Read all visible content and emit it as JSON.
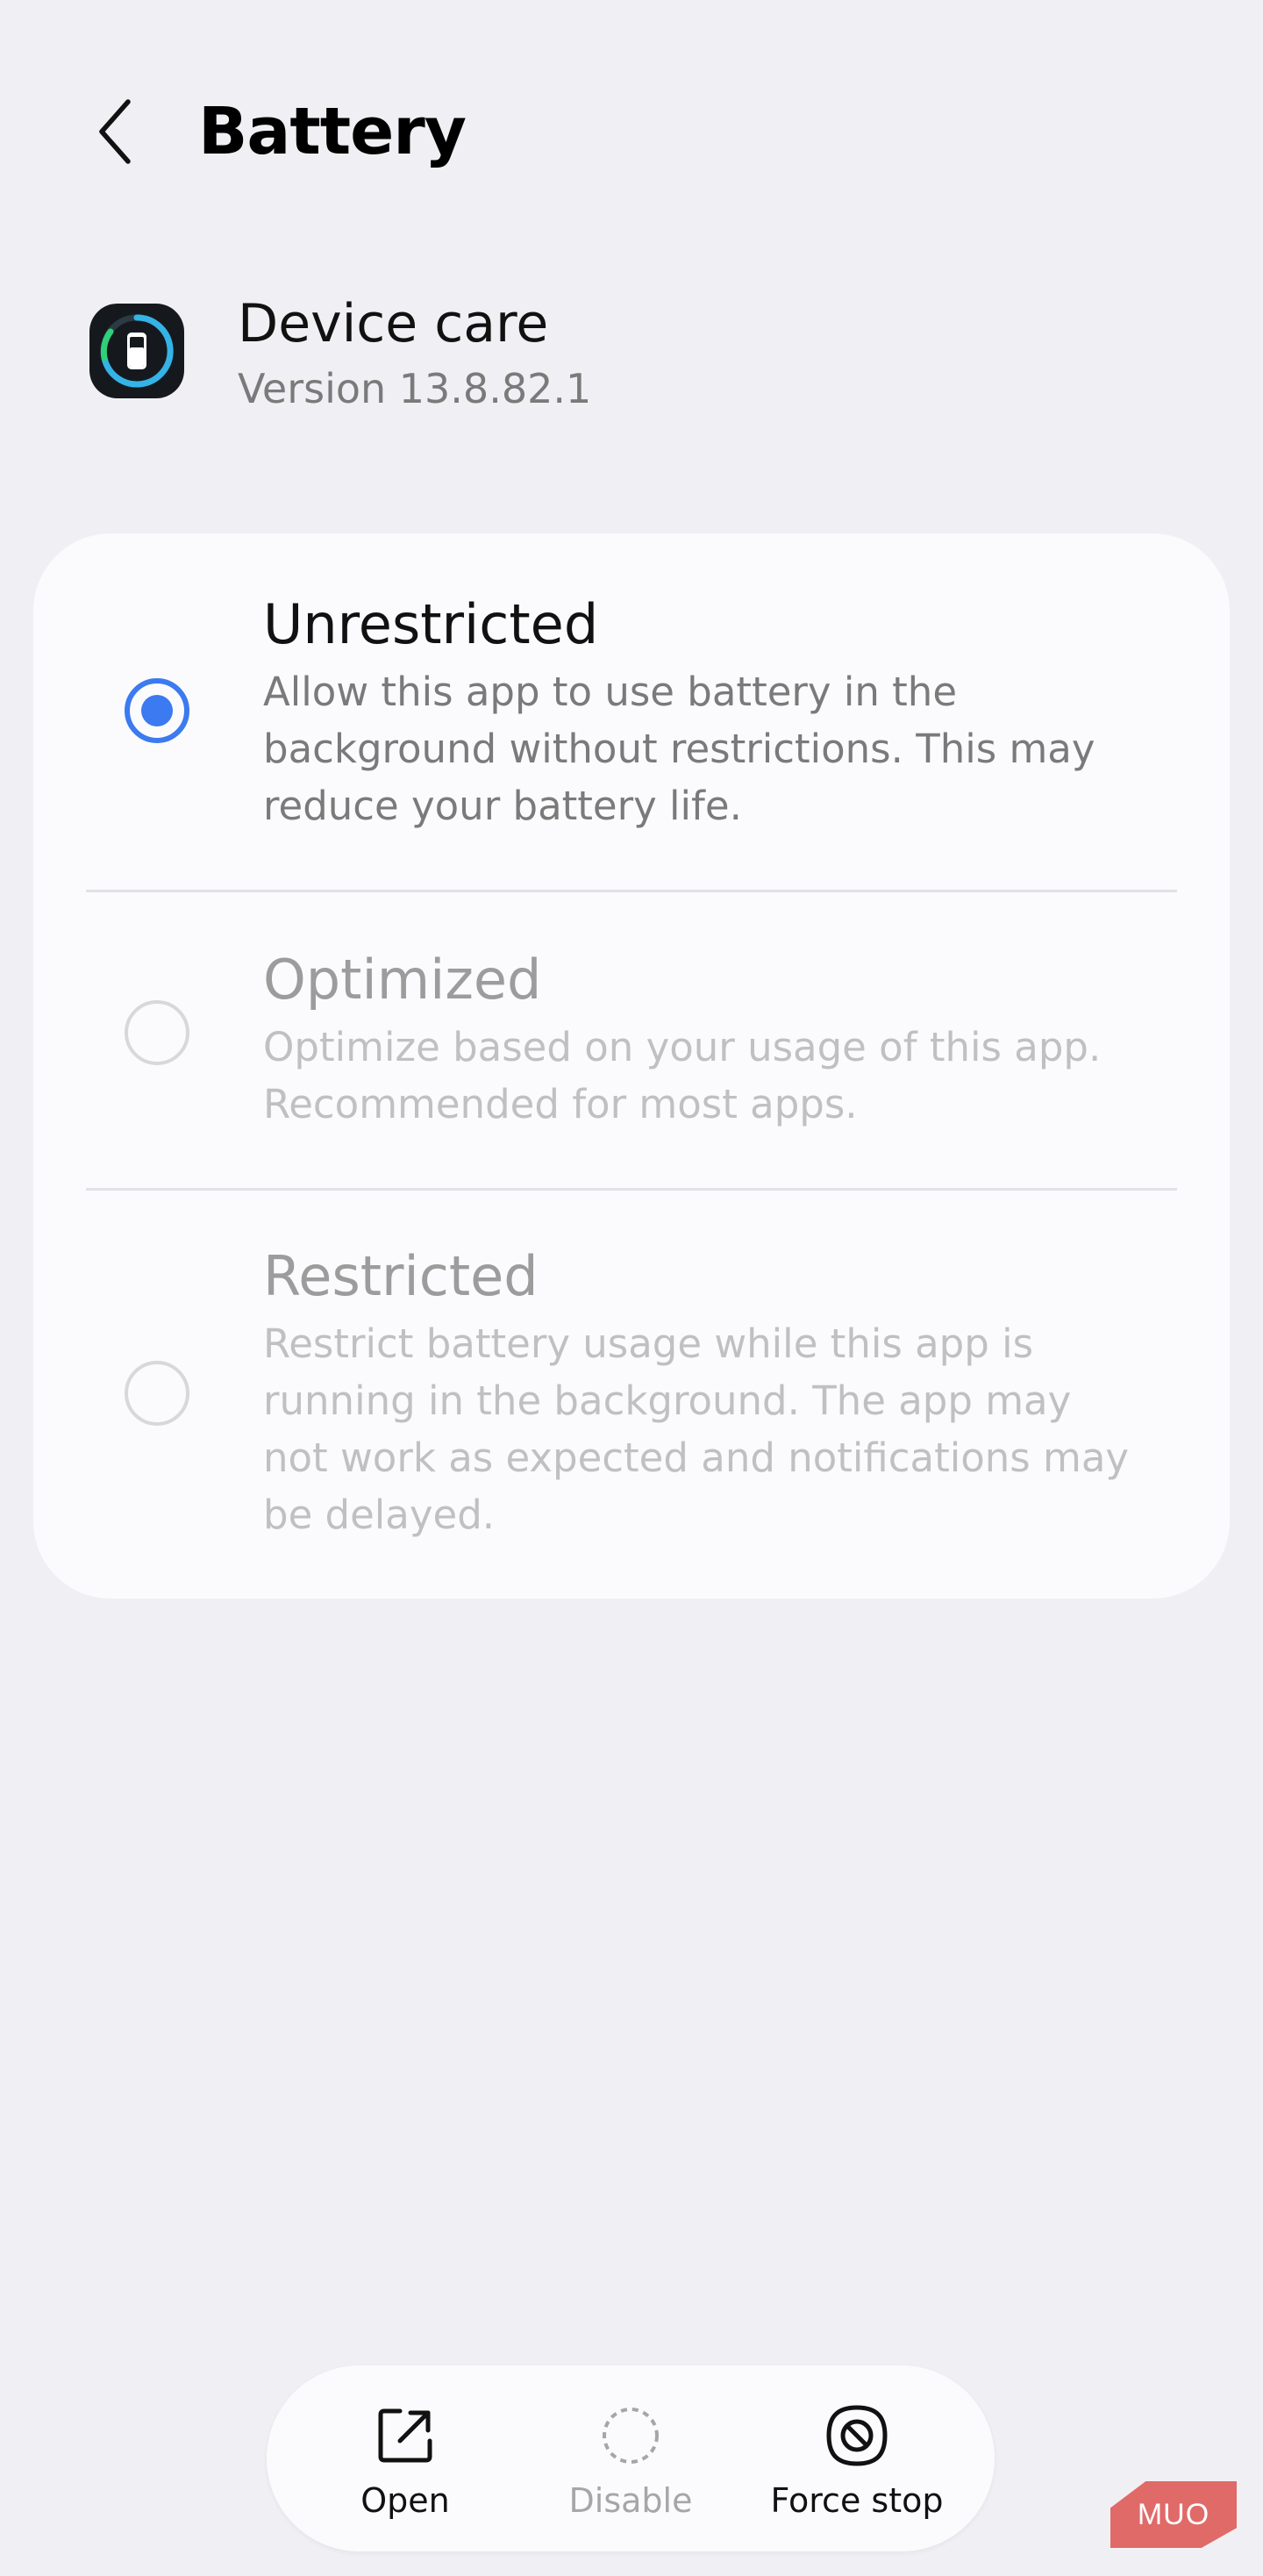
{
  "header": {
    "title": "Battery",
    "back_icon": "chevron-left-icon"
  },
  "app": {
    "name": "Device care",
    "version": "Version 13.8.82.1",
    "icon": "device-care-icon"
  },
  "options": [
    {
      "title": "Unrestricted",
      "description": "Allow this app to use battery in the background without restrictions. This may reduce your battery life.",
      "selected": true,
      "enabled": true
    },
    {
      "title": "Optimized",
      "description": "Optimize based on your usage of this app. Recommended for most apps.",
      "selected": false,
      "enabled": false
    },
    {
      "title": "Restricted",
      "description": "Restrict battery usage while this app is running in the background. The app may not work as expected and notifications may be delayed.",
      "selected": false,
      "enabled": false
    }
  ],
  "bottom_bar": {
    "open": {
      "label": "Open",
      "icon": "open-external-icon",
      "enabled": true
    },
    "disable": {
      "label": "Disable",
      "icon": "disable-dashed-circle-icon",
      "enabled": false
    },
    "force_stop": {
      "label": "Force stop",
      "icon": "force-stop-icon",
      "enabled": true
    }
  },
  "watermark": {
    "text": "MUO"
  },
  "colors": {
    "accent": "#3b7af0",
    "background": "#f0f0f4",
    "card": "#fbfbfd",
    "watermark": "#e06a68"
  }
}
